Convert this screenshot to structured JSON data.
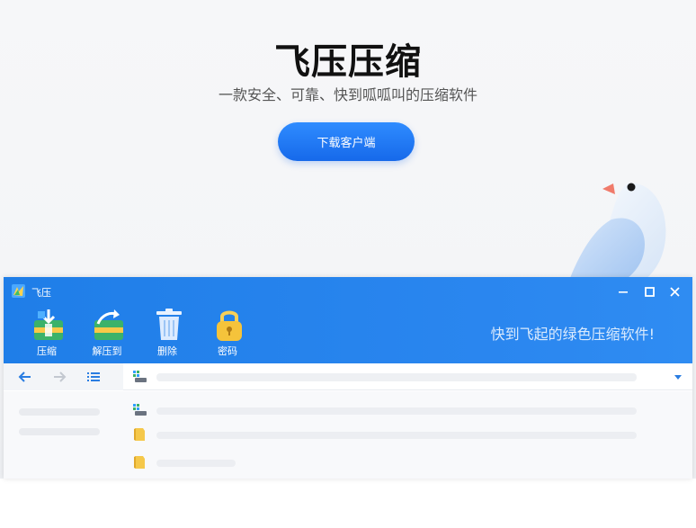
{
  "hero": {
    "title": "飞压压缩",
    "subtitle": "一款安全、可靠、快到呱呱叫的压缩软件",
    "download_label": "下载客户端"
  },
  "window": {
    "title": "飞压",
    "controls": [
      "minimize",
      "maximize",
      "close"
    ],
    "toolbar": [
      {
        "label": "压缩",
        "icon": "compress-icon"
      },
      {
        "label": "解压到",
        "icon": "extract-icon"
      },
      {
        "label": "删除",
        "icon": "trash-icon"
      },
      {
        "label": "密码",
        "icon": "lock-icon"
      }
    ],
    "slogan": "快到飞起的绿色压缩软件!"
  },
  "colors": {
    "brand_blue": "#1f7ee8",
    "button_blue": "#1669ea",
    "folder_yellow": "#f5c84a"
  }
}
